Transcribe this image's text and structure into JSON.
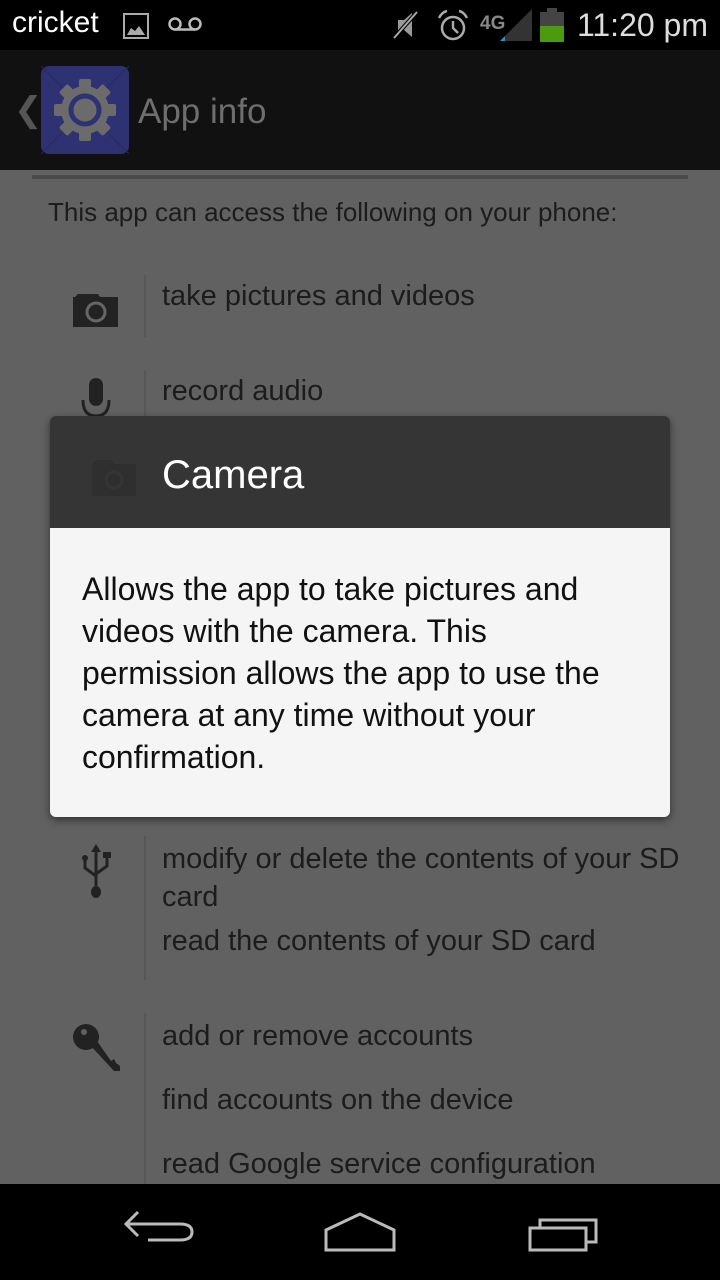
{
  "status_bar": {
    "carrier": "cricket",
    "notification_icons": [
      "picture-icon",
      "voicemail-icon"
    ],
    "system_icons": [
      "mute-icon",
      "alarm-icon",
      "4g-signal-icon",
      "battery-icon"
    ],
    "network_label": "4G",
    "time": "11:20 pm",
    "battery_color": "#4a9a12"
  },
  "action_bar": {
    "up_caret": "❮",
    "title": "App info",
    "icon": "settings-gear-icon"
  },
  "content": {
    "intro": "This app can access the following on your phone:",
    "groups": [
      {
        "icon": "camera-icon",
        "items": [
          "take pictures and videos"
        ]
      },
      {
        "icon": "microphone-icon",
        "items": [
          "record audio"
        ]
      },
      {
        "icon": "usb-storage-icon",
        "items": [
          "modify or delete the contents of your SD card",
          "read the contents of your SD card"
        ]
      },
      {
        "icon": "key-icon",
        "items": [
          "add or remove accounts",
          "find accounts on the device",
          "read Google service configuration"
        ]
      }
    ]
  },
  "dialog": {
    "title": "Camera",
    "icon": "camera-icon",
    "body": "Allows the app to take pictures and videos with the camera. This permission allows the app to use the camera at any time without your confirmation."
  },
  "nav_bar": {
    "buttons": [
      "back",
      "home",
      "recent-apps"
    ]
  }
}
